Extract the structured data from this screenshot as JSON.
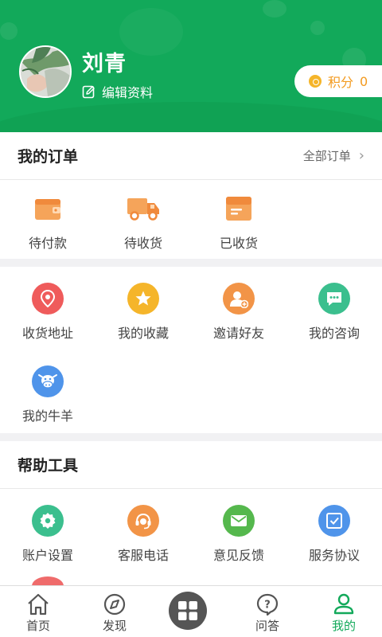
{
  "profile": {
    "name": "刘青",
    "edit_label": "编辑资料",
    "points_label": "积分",
    "points_value": "0"
  },
  "orders": {
    "title": "我的订单",
    "all_label": "全部订单",
    "items": [
      {
        "label": "待付款",
        "icon": "wallet-icon"
      },
      {
        "label": "待收货",
        "icon": "truck-icon"
      },
      {
        "label": "已收货",
        "icon": "box-icon"
      }
    ]
  },
  "services": {
    "items": [
      {
        "label": "收货地址",
        "icon": "location-pin-icon",
        "color": "#ef5b5b"
      },
      {
        "label": "我的收藏",
        "icon": "star-icon",
        "color": "#f5b52a"
      },
      {
        "label": "邀请好友",
        "icon": "add-friend-icon",
        "color": "#f29447"
      },
      {
        "label": "我的咨询",
        "icon": "chat-icon",
        "color": "#3bbf8e"
      },
      {
        "label": "我的牛羊",
        "icon": "cow-icon",
        "color": "#4f94ea"
      }
    ]
  },
  "help": {
    "title": "帮助工具",
    "items": [
      {
        "label": "账户设置",
        "icon": "settings-icon",
        "color": "#3bbf8e"
      },
      {
        "label": "客服电话",
        "icon": "headset-icon",
        "color": "#f29447"
      },
      {
        "label": "意见反馈",
        "icon": "mail-icon",
        "color": "#55b84d"
      },
      {
        "label": "服务协议",
        "icon": "agreement-icon",
        "color": "#4f94ea"
      }
    ]
  },
  "tabbar": {
    "items": [
      {
        "label": "首页",
        "icon": "home-icon"
      },
      {
        "label": "发现",
        "icon": "compass-icon"
      },
      {
        "label": "",
        "icon": "grid-icon"
      },
      {
        "label": "问答",
        "icon": "question-icon"
      },
      {
        "label": "我的",
        "icon": "user-icon",
        "active": true
      }
    ]
  },
  "colors": {
    "brand": "#12a95a",
    "points": "#f39a1e"
  }
}
